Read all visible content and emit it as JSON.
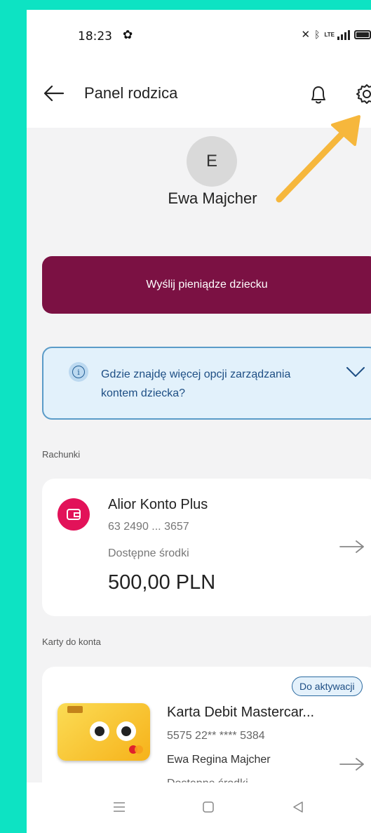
{
  "status_bar": {
    "time": "18:23",
    "network": "LTE"
  },
  "header": {
    "back_icon": "arrow-left-icon",
    "title": "Panel rodzica",
    "notification_icon": "bell-icon",
    "settings_icon": "gear-icon"
  },
  "profile": {
    "avatar_initial": "E",
    "name": "Ewa Majcher"
  },
  "send_money_button": "Wyślij pieniądze dziecku",
  "info_box": {
    "text": "Gdzie znajdę więcej opcji zarządzania kontem dziecka?"
  },
  "accounts": {
    "section_label": "Rachunki",
    "items": [
      {
        "name": "Alior Konto Plus",
        "number": "63 2490 ... 3657",
        "available_label": "Dostępne środki",
        "balance": "500,00 PLN"
      }
    ]
  },
  "cards": {
    "section_label": "Karty do konta",
    "items": [
      {
        "badge": "Do aktywacji",
        "name": "Karta Debit Mastercar...",
        "number": "5575 22** **** 5384",
        "holder": "Ewa Regina Majcher",
        "available_label": "Dostępne środki"
      }
    ]
  },
  "colors": {
    "background": "#0de3c3",
    "primary_button": "#7b1143",
    "account_icon": "#e21259",
    "info_border": "#5a9bc8",
    "annotation_arrow": "#f6b73c"
  }
}
